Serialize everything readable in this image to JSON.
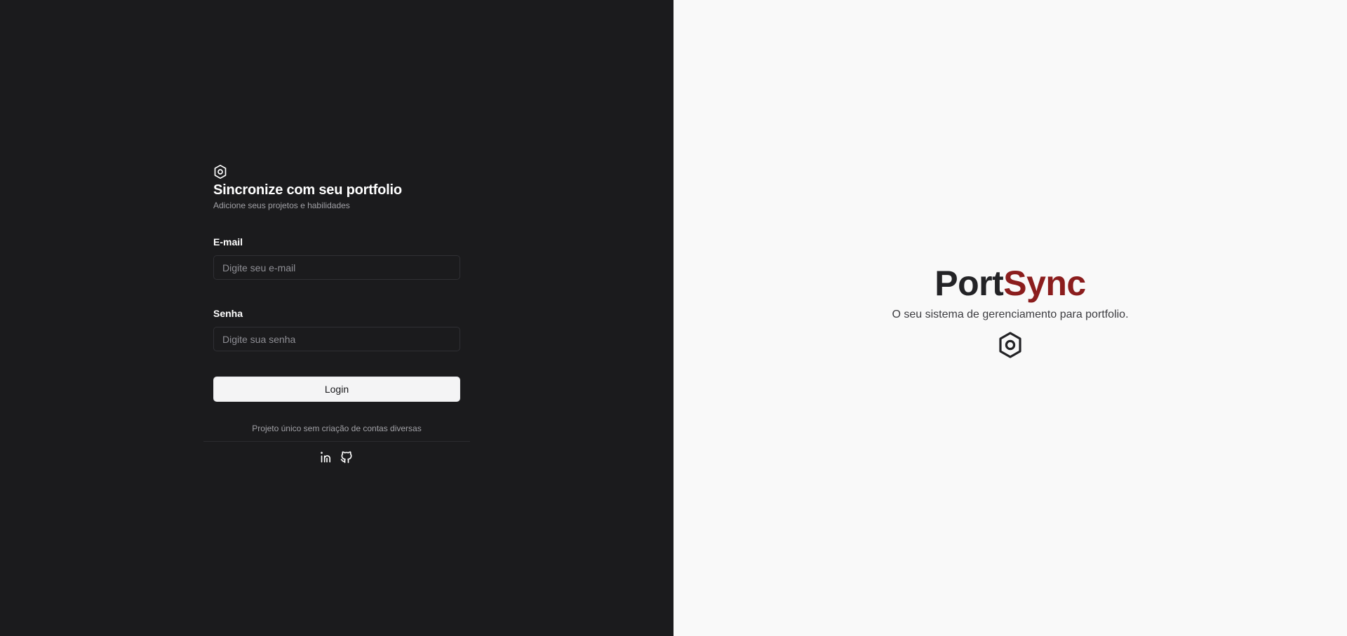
{
  "login_panel": {
    "brand_icon": "hexagon-nut-icon",
    "heading": "Sincronize com seu portfolio",
    "subheading": "Adicione seus projetos e habilidades",
    "email": {
      "label": "E-mail",
      "placeholder": "Digite seu e-mail",
      "value": ""
    },
    "password": {
      "label": "Senha",
      "placeholder": "Digite sua senha",
      "value": ""
    },
    "login_button": "Login",
    "footnote": "Projeto único sem criação de contas diversas",
    "social": [
      {
        "name": "linkedin",
        "icon": "linkedin-icon"
      },
      {
        "name": "github",
        "icon": "github-icon"
      }
    ],
    "colors": {
      "background": "#1b1b1d",
      "text": "#ffffff",
      "muted": "#a1a1a6"
    }
  },
  "hero_panel": {
    "logo_part1": "Port",
    "logo_part2": "Sync",
    "tagline": "O seu sistema de gerenciamento para portfolio.",
    "icon": "hexagon-nut-icon",
    "colors": {
      "background": "#f9f9f9",
      "logo_dark": "#232326",
      "logo_accent": "#8b1d1d"
    }
  }
}
